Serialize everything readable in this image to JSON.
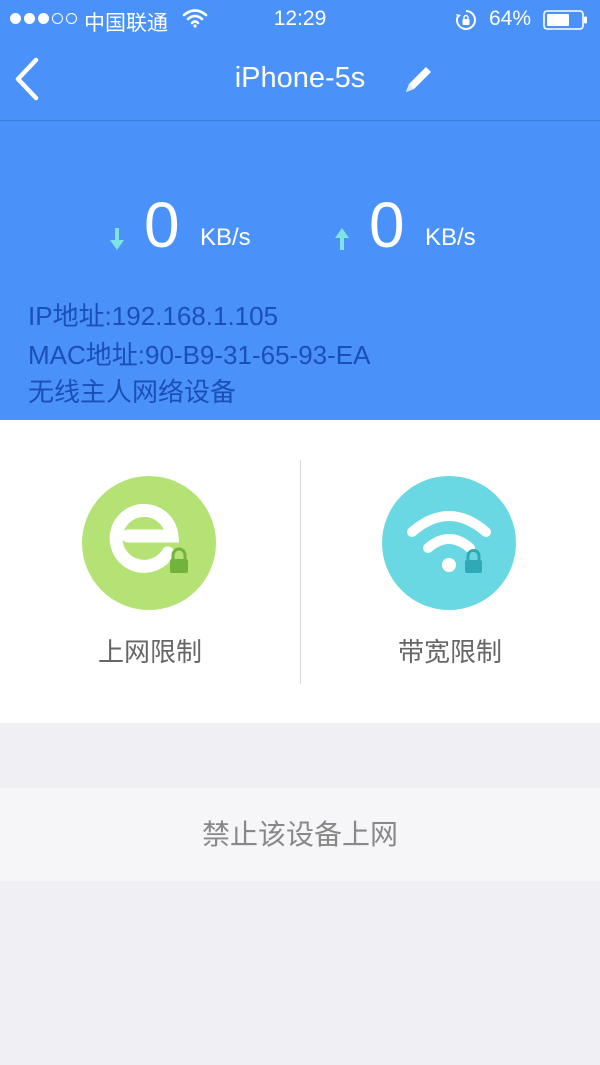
{
  "status_bar": {
    "carrier": "中国联通",
    "time": "12:29",
    "battery": "64%",
    "icons": [
      "signal-dots",
      "wifi-icon",
      "rotation-lock-icon",
      "battery-icon"
    ]
  },
  "nav": {
    "title": "iPhone-5s",
    "back_icon": "chevron-left-icon",
    "edit_icon": "pencil-icon"
  },
  "speed": {
    "download": {
      "value": "0",
      "unit": "KB/s",
      "icon": "arrow-down-icon"
    },
    "upload": {
      "value": "0",
      "unit": "KB/s",
      "icon": "arrow-up-icon"
    }
  },
  "device": {
    "ip": "IP地址:192.168.1.105",
    "mac": "MAC地址:90-B9-31-65-93-EA",
    "type": "无线主人网络设备"
  },
  "options": [
    {
      "label": "上网限制",
      "icon": "browser-e-lock-icon",
      "color": "#b5e274"
    },
    {
      "label": "带宽限制",
      "icon": "wifi-lock-icon",
      "color": "#6ad8e3"
    }
  ],
  "actions": {
    "block_label": "禁止该设备上网"
  },
  "colors": {
    "header_bg": "#4a92f9",
    "info_text": "#1b4fb8",
    "arrow": "#7fe3e3",
    "page_bg": "#efeff4"
  }
}
